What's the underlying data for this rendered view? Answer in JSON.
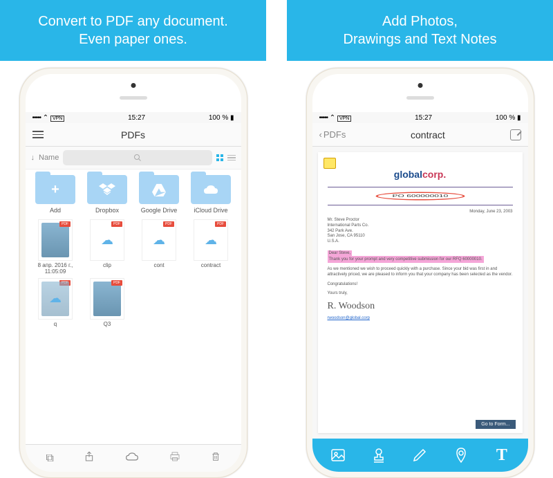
{
  "banners": {
    "left_line1": "Convert to PDF any document.",
    "left_line2": "Even paper ones.",
    "right_line1": "Add Photos,",
    "right_line2": "Drawings and Text Notes"
  },
  "status": {
    "carrier": "•••••",
    "network": "VPN",
    "time": "15:27",
    "battery": "100 %"
  },
  "left_screen": {
    "nav_title": "PDFs",
    "sort_arrow": "↓",
    "sort_label": "Name",
    "folders": [
      {
        "label": "Add",
        "icon": "+"
      },
      {
        "label": "Dropbox",
        "icon": "dropbox"
      },
      {
        "label": "Google Drive",
        "icon": "drive"
      },
      {
        "label": "iCloud Drive",
        "icon": "cloud"
      }
    ],
    "files": [
      {
        "label": "8 апр. 2016 г., 11:05:09",
        "type": "preview"
      },
      {
        "label": "clip",
        "type": "cloud"
      },
      {
        "label": "cont",
        "type": "cloud"
      },
      {
        "label": "contract",
        "type": "cloud"
      },
      {
        "label": "q",
        "type": "preview-cloud"
      },
      {
        "label": "Q3",
        "type": "preview"
      }
    ]
  },
  "right_screen": {
    "back_label": "PDFs",
    "nav_title": "contract",
    "logo_part1": "global",
    "logo_part2": "corp.",
    "po_number": "PO 600000010",
    "date": "Monday, June 23, 2003",
    "addr_line1": "Mr. Steve Proctor",
    "addr_line2": "International Parts Co.",
    "addr_line3": "342 Park Ave.",
    "addr_line4": "San Jose, CA 95110",
    "addr_line5": "U.S.A.",
    "salutation": "Dear Steve,",
    "highlight_text": "Thank you for your prompt and very competitive submission for our RFQ 60000010.",
    "body": "As we mentioned we wish to proceed quickly with a purchase. Since your bid was first in and attractively priced, we are pleased to inform you that your company has been selected as the vendor.",
    "congrats": "Congratulations!",
    "closing": "Yours truly,",
    "signature": "R. Woodson",
    "link": "rwoodson@global.corp",
    "form_btn": "Go to Form..."
  }
}
